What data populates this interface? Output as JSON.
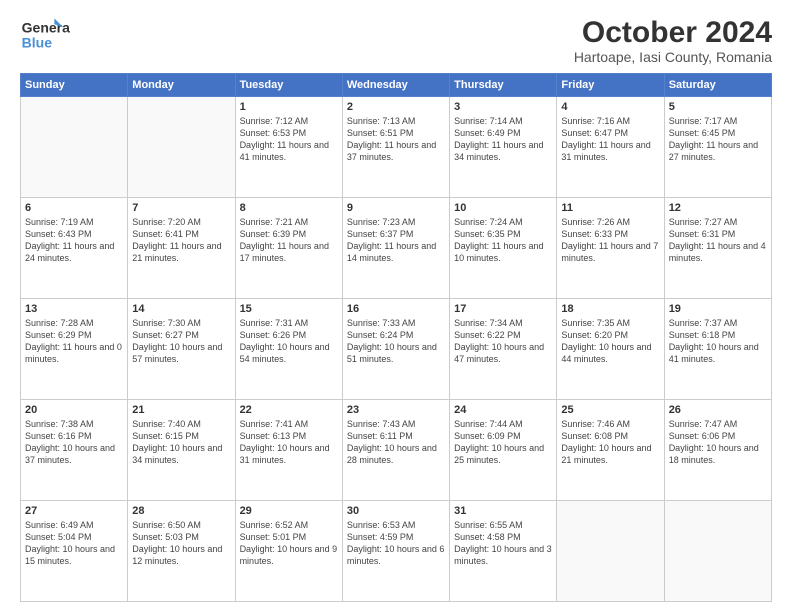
{
  "header": {
    "logo_line1": "General",
    "logo_line2": "Blue",
    "month": "October 2024",
    "location": "Hartoape, Iasi County, Romania"
  },
  "weekdays": [
    "Sunday",
    "Monday",
    "Tuesday",
    "Wednesday",
    "Thursday",
    "Friday",
    "Saturday"
  ],
  "weeks": [
    [
      {
        "day": "",
        "info": ""
      },
      {
        "day": "",
        "info": ""
      },
      {
        "day": "1",
        "info": "Sunrise: 7:12 AM\nSunset: 6:53 PM\nDaylight: 11 hours and 41 minutes."
      },
      {
        "day": "2",
        "info": "Sunrise: 7:13 AM\nSunset: 6:51 PM\nDaylight: 11 hours and 37 minutes."
      },
      {
        "day": "3",
        "info": "Sunrise: 7:14 AM\nSunset: 6:49 PM\nDaylight: 11 hours and 34 minutes."
      },
      {
        "day": "4",
        "info": "Sunrise: 7:16 AM\nSunset: 6:47 PM\nDaylight: 11 hours and 31 minutes."
      },
      {
        "day": "5",
        "info": "Sunrise: 7:17 AM\nSunset: 6:45 PM\nDaylight: 11 hours and 27 minutes."
      }
    ],
    [
      {
        "day": "6",
        "info": "Sunrise: 7:19 AM\nSunset: 6:43 PM\nDaylight: 11 hours and 24 minutes."
      },
      {
        "day": "7",
        "info": "Sunrise: 7:20 AM\nSunset: 6:41 PM\nDaylight: 11 hours and 21 minutes."
      },
      {
        "day": "8",
        "info": "Sunrise: 7:21 AM\nSunset: 6:39 PM\nDaylight: 11 hours and 17 minutes."
      },
      {
        "day": "9",
        "info": "Sunrise: 7:23 AM\nSunset: 6:37 PM\nDaylight: 11 hours and 14 minutes."
      },
      {
        "day": "10",
        "info": "Sunrise: 7:24 AM\nSunset: 6:35 PM\nDaylight: 11 hours and 10 minutes."
      },
      {
        "day": "11",
        "info": "Sunrise: 7:26 AM\nSunset: 6:33 PM\nDaylight: 11 hours and 7 minutes."
      },
      {
        "day": "12",
        "info": "Sunrise: 7:27 AM\nSunset: 6:31 PM\nDaylight: 11 hours and 4 minutes."
      }
    ],
    [
      {
        "day": "13",
        "info": "Sunrise: 7:28 AM\nSunset: 6:29 PM\nDaylight: 11 hours and 0 minutes."
      },
      {
        "day": "14",
        "info": "Sunrise: 7:30 AM\nSunset: 6:27 PM\nDaylight: 10 hours and 57 minutes."
      },
      {
        "day": "15",
        "info": "Sunrise: 7:31 AM\nSunset: 6:26 PM\nDaylight: 10 hours and 54 minutes."
      },
      {
        "day": "16",
        "info": "Sunrise: 7:33 AM\nSunset: 6:24 PM\nDaylight: 10 hours and 51 minutes."
      },
      {
        "day": "17",
        "info": "Sunrise: 7:34 AM\nSunset: 6:22 PM\nDaylight: 10 hours and 47 minutes."
      },
      {
        "day": "18",
        "info": "Sunrise: 7:35 AM\nSunset: 6:20 PM\nDaylight: 10 hours and 44 minutes."
      },
      {
        "day": "19",
        "info": "Sunrise: 7:37 AM\nSunset: 6:18 PM\nDaylight: 10 hours and 41 minutes."
      }
    ],
    [
      {
        "day": "20",
        "info": "Sunrise: 7:38 AM\nSunset: 6:16 PM\nDaylight: 10 hours and 37 minutes."
      },
      {
        "day": "21",
        "info": "Sunrise: 7:40 AM\nSunset: 6:15 PM\nDaylight: 10 hours and 34 minutes."
      },
      {
        "day": "22",
        "info": "Sunrise: 7:41 AM\nSunset: 6:13 PM\nDaylight: 10 hours and 31 minutes."
      },
      {
        "day": "23",
        "info": "Sunrise: 7:43 AM\nSunset: 6:11 PM\nDaylight: 10 hours and 28 minutes."
      },
      {
        "day": "24",
        "info": "Sunrise: 7:44 AM\nSunset: 6:09 PM\nDaylight: 10 hours and 25 minutes."
      },
      {
        "day": "25",
        "info": "Sunrise: 7:46 AM\nSunset: 6:08 PM\nDaylight: 10 hours and 21 minutes."
      },
      {
        "day": "26",
        "info": "Sunrise: 7:47 AM\nSunset: 6:06 PM\nDaylight: 10 hours and 18 minutes."
      }
    ],
    [
      {
        "day": "27",
        "info": "Sunrise: 6:49 AM\nSunset: 5:04 PM\nDaylight: 10 hours and 15 minutes."
      },
      {
        "day": "28",
        "info": "Sunrise: 6:50 AM\nSunset: 5:03 PM\nDaylight: 10 hours and 12 minutes."
      },
      {
        "day": "29",
        "info": "Sunrise: 6:52 AM\nSunset: 5:01 PM\nDaylight: 10 hours and 9 minutes."
      },
      {
        "day": "30",
        "info": "Sunrise: 6:53 AM\nSunset: 4:59 PM\nDaylight: 10 hours and 6 minutes."
      },
      {
        "day": "31",
        "info": "Sunrise: 6:55 AM\nSunset: 4:58 PM\nDaylight: 10 hours and 3 minutes."
      },
      {
        "day": "",
        "info": ""
      },
      {
        "day": "",
        "info": ""
      }
    ]
  ]
}
